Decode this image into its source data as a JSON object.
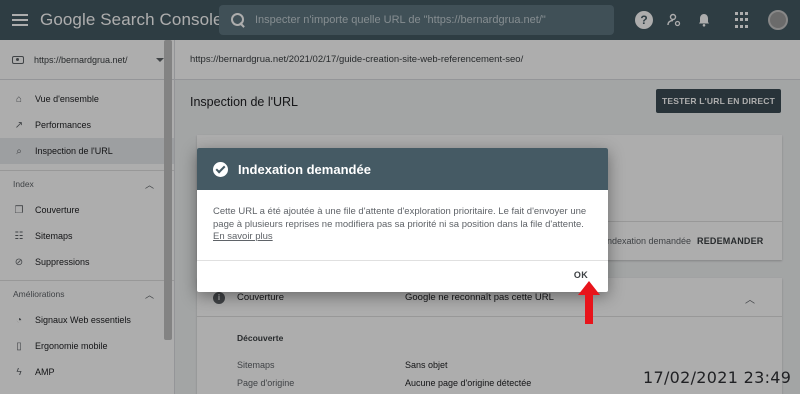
{
  "topbar": {
    "app_title": "Google Search Console",
    "search_placeholder": "Inspecter n'importe quelle URL de \"https://bernardgrua.net/\""
  },
  "sidebar": {
    "property": "https://bernardgrua.net/",
    "items": [
      {
        "label": "Vue d'ensemble",
        "icon": "home-icon"
      },
      {
        "label": "Performances",
        "icon": "trend-icon"
      },
      {
        "label": "Inspection de l'URL",
        "icon": "search-icon"
      }
    ],
    "index_header": "Index",
    "index_items": [
      {
        "label": "Couverture",
        "icon": "copy-icon"
      },
      {
        "label": "Sitemaps",
        "icon": "sitemap-icon"
      },
      {
        "label": "Suppressions",
        "icon": "visibility-off-icon"
      }
    ],
    "enhancements_header": "Améliorations",
    "enhancements_items": [
      {
        "label": "Signaux Web essentiels",
        "icon": "speed-icon"
      },
      {
        "label": "Ergonomie mobile",
        "icon": "phone-icon"
      },
      {
        "label": "AMP",
        "icon": "bolt-icon"
      }
    ]
  },
  "main": {
    "url": "https://bernardgrua.net/2021/02/17/guide-creation-site-web-referencement-seo/",
    "title": "Inspection de l'URL",
    "test_button": "TESTER L'URL EN DIRECT",
    "card1": {
      "status": "ndexation demandée",
      "reask_button": "REDEMANDER"
    },
    "coverage": {
      "label": "Couverture",
      "value": "Google ne reconnaît pas cette URL",
      "discovery_header": "Découverte",
      "rows": [
        {
          "label": "Sitemaps",
          "value": "Sans objet"
        },
        {
          "label": "Page d'origine",
          "value": "Aucune page d'origine détectée"
        }
      ]
    }
  },
  "dialog": {
    "title": "Indexation demandée",
    "body": "Cette URL a été ajoutée à une file d'attente d'exploration prioritaire. Le fait d'envoyer une page à plusieurs reprises ne modifiera pas sa priorité ni sa position dans la file d'attente.",
    "link": "En savoir plus",
    "ok_button": "OK"
  },
  "timestamp": "17/02/2021 23:49",
  "colors": {
    "header": "#455a64",
    "arrow": "#e8141b"
  }
}
